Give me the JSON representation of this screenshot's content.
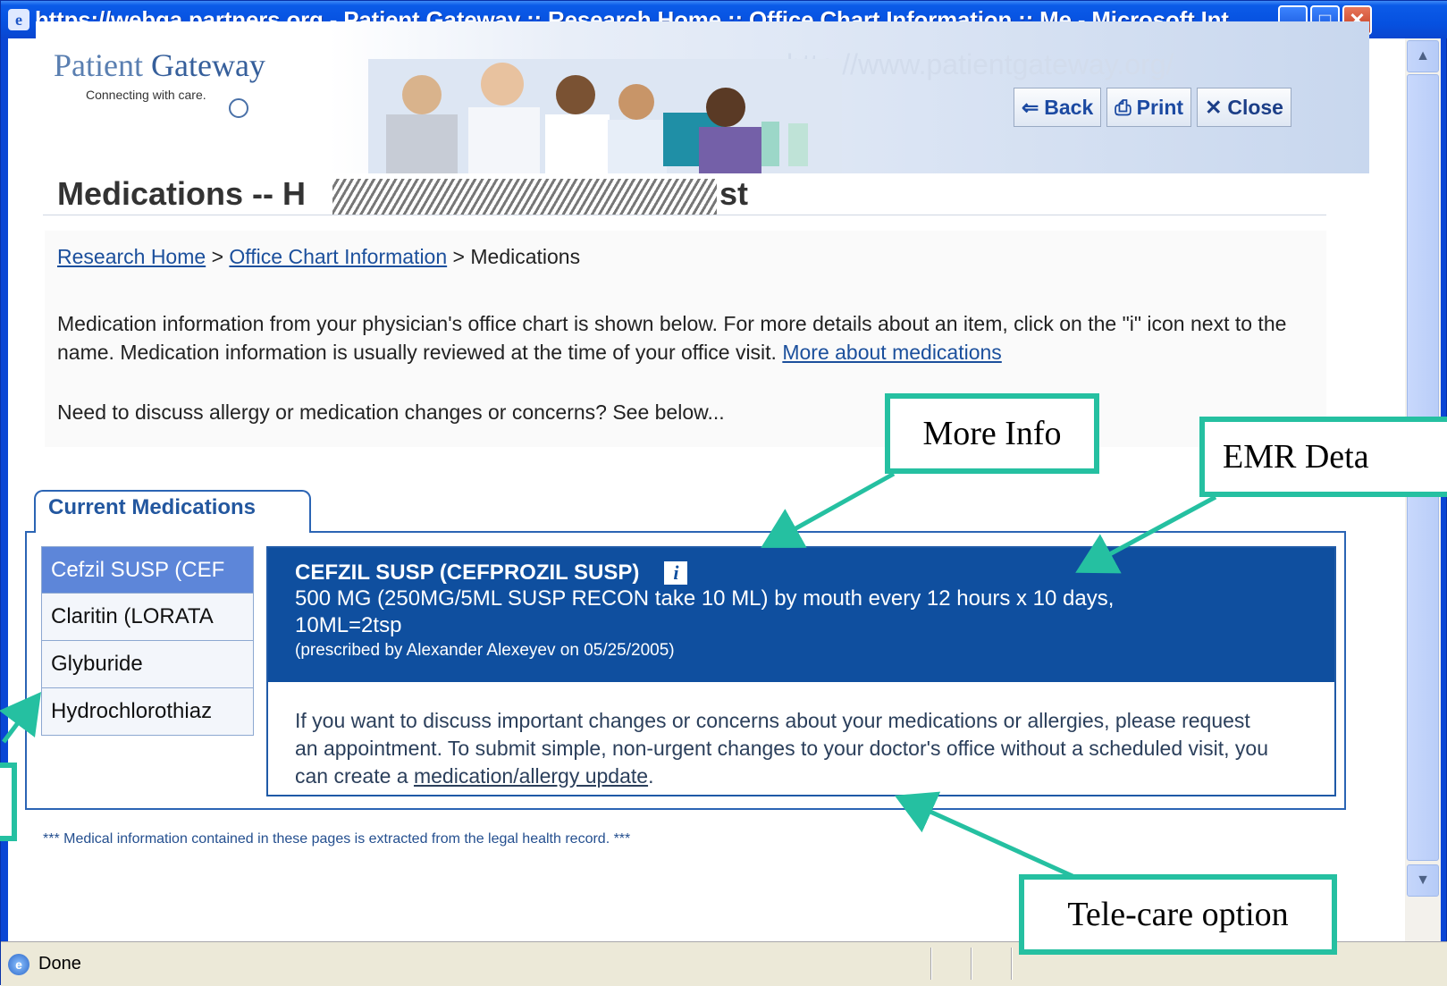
{
  "window": {
    "title": "https://webqa.partners.org - Patient Gateway :: Research Home :: Office Chart Information :: Me - Microsoft Int...",
    "status": "Done"
  },
  "header": {
    "logo_word1": "Patient",
    "logo_word2": "Gateway",
    "tagline": "Connecting with care.",
    "banner_text": "http://www.patientgateway.org/",
    "back_label": "Back",
    "print_label": "Print",
    "close_label": "Close"
  },
  "page": {
    "title_start": "Medications -- H",
    "title_end": "st",
    "breadcrumb": {
      "home": "Research Home",
      "sep1": " > ",
      "office": "Office Chart Information",
      "sep2": " > ",
      "current": "Medications"
    },
    "intro_text": "Medication information from your physician's office chart is shown below. For more details about an item, click on the \"i\" icon next to the name. Medication information is usually reviewed at the time of your office visit. ",
    "more_link": "More about medications",
    "need_text": "Need to discuss allergy or medication changes or concerns? See below..."
  },
  "medications": {
    "tab_label": "Current Medications",
    "items": [
      {
        "label": "Cefzil SUSP (CEF",
        "selected": true
      },
      {
        "label": "Claritin (LORATA"
      },
      {
        "label": "Glyburide"
      },
      {
        "label": "Hydrochlorothiaz"
      }
    ],
    "detail": {
      "name": "CEFZIL SUSP (CEFPROZIL SUSP)",
      "dose": "500 MG (250MG/5ML SUSP RECON take 10 ML) by mouth every 12 hours x 10 days, 10ML=2tsp",
      "prescribed": "(prescribed by Alexander Alexeyev on 05/25/2005)",
      "body_text": "If you want to discuss important changes or concerns about your medications or allergies, please request an appointment. To submit simple, non-urgent changes to your doctor's office without a scheduled visit, you can create a ",
      "update_link": "medication/allergy update",
      "body_end": "."
    }
  },
  "footer_note": "*** Medical information contained in these pages is extracted from the legal health record. ***",
  "annotations": {
    "more_info": "More Info",
    "emr_detail": "EMR Deta",
    "telecare": "Tele-care option"
  },
  "colors": {
    "accent": "#25c0a1",
    "header_blue": "#0f4f9f",
    "selected_item": "#5d86d9"
  }
}
